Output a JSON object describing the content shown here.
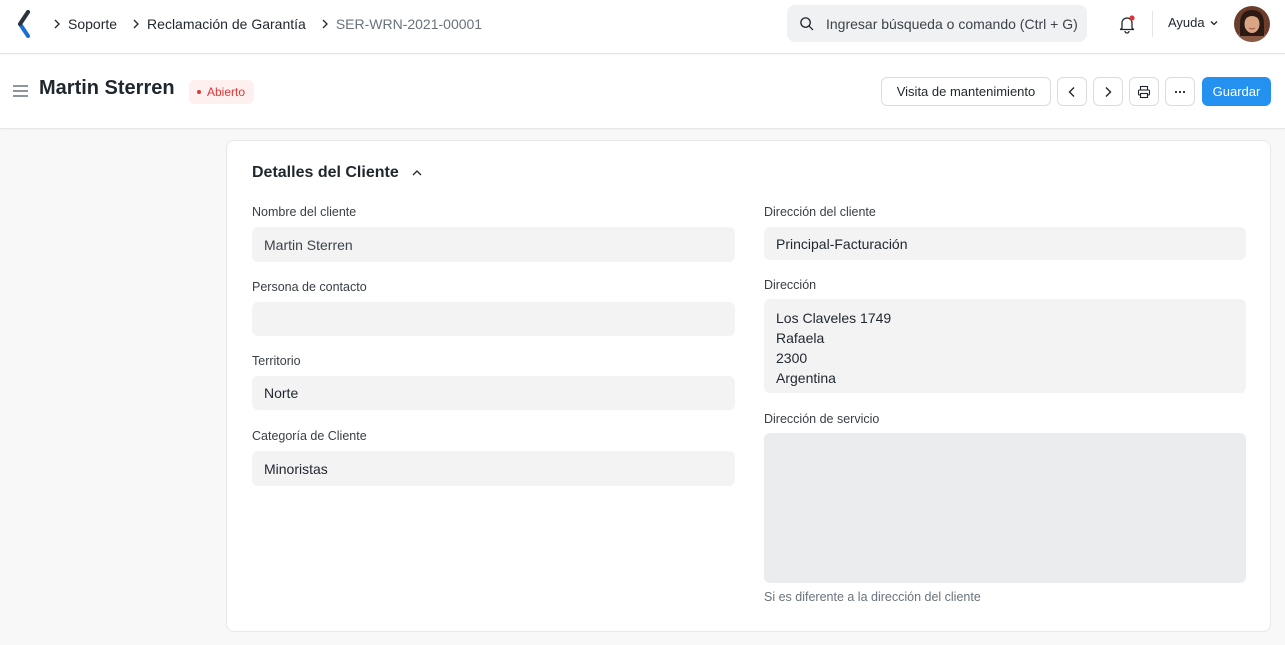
{
  "navbar": {
    "breadcrumbs": [
      "Soporte",
      "Reclamación de Garantía",
      "SER-WRN-2021-00001"
    ],
    "search_placeholder": "Ingresar búsqueda o comando (Ctrl + G)",
    "help_label": "Ayuda",
    "icons": [
      "logo-icon",
      "search-icon",
      "bell-icon",
      "chevron-down-icon",
      "avatar"
    ]
  },
  "page_head": {
    "title": "Martin Sterren",
    "status": "Abierto",
    "maintenance_visit_label": "Visita de mantenimiento",
    "save_label": "Guardar",
    "colors": {
      "primary": "#2490ef",
      "status_text": "#e03636",
      "status_bg": "#fff0f0"
    }
  },
  "section": {
    "title": "Detalles del Cliente",
    "left": {
      "customer_name_label": "Nombre del cliente",
      "customer_name_value": "Martin Sterren",
      "contact_person_label": "Persona de contacto",
      "contact_person_value": "",
      "territory_label": "Territorio",
      "territory_value": "Norte",
      "customer_group_label": "Categoría de Cliente",
      "customer_group_value": "Minoristas"
    },
    "right": {
      "customer_address_label": "Dirección del cliente",
      "customer_address_value": "Principal-Facturación",
      "address_label": "Dirección",
      "address_lines": [
        "Los Claveles 1749",
        "Rafaela",
        "2300",
        "Argentina"
      ],
      "service_address_label": "Dirección de servicio",
      "service_address_value": "",
      "service_address_help": "Si es diferente a la dirección del cliente"
    }
  }
}
